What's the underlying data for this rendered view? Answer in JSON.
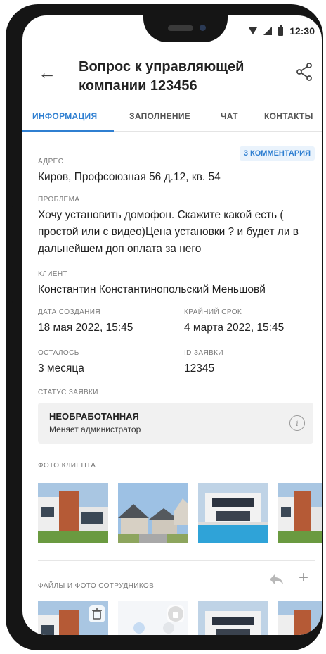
{
  "status_bar": {
    "time": "12:30"
  },
  "header": {
    "title": "Вопрос к управляющей компании 123456"
  },
  "tabs": [
    {
      "label": "ИНФОРМАЦИЯ"
    },
    {
      "label": "ЗАПОЛНЕНИЕ"
    },
    {
      "label": "ЧАТ"
    },
    {
      "label": "КОНТАКТЫ"
    }
  ],
  "comments_badge": "3 КОММЕНТАРИЯ",
  "address": {
    "label": "АДРЕС",
    "value": "Киров, Профсоюзная 56 д.12, кв. 54"
  },
  "problem": {
    "label": "ПРОБЛЕМА",
    "value": "Хочу установить домофон. Скажите какой есть ( простой или с видео)Цена установки ? и будет ли в дальнейшем доп оплата за него"
  },
  "client": {
    "label": "КЛИЕНТ",
    "value": "Константин Константинопольский Меньшовй"
  },
  "created": {
    "label": "ДАТА СОЗДАНИЯ",
    "value": "18 мая 2022, 15:45"
  },
  "deadline": {
    "label": "КРАЙНИЙ СРОК",
    "value": "4 марта 2022, 15:45"
  },
  "remaining": {
    "label": "ОСТАЛОСЬ",
    "value": "3 месяца"
  },
  "request_id": {
    "label": "ID ЗАЯВКИ",
    "value": "12345"
  },
  "request_status": {
    "label": "СТАТУС ЗАЯВКИ",
    "title": "НЕОБРАБОТАННАЯ",
    "subtitle": "Меняет администратор"
  },
  "client_photos": {
    "label": "ФОТО КЛИЕНТА"
  },
  "staff_files": {
    "label": "ФАЙЛЫ И ФОТО СОТРУДНИКОВ"
  },
  "colors": {
    "accent": "#2f7fd1"
  },
  "icons": [
    "back-arrow-icon",
    "share-icon",
    "info-icon",
    "reply-icon",
    "plus-icon",
    "trash-icon"
  ]
}
